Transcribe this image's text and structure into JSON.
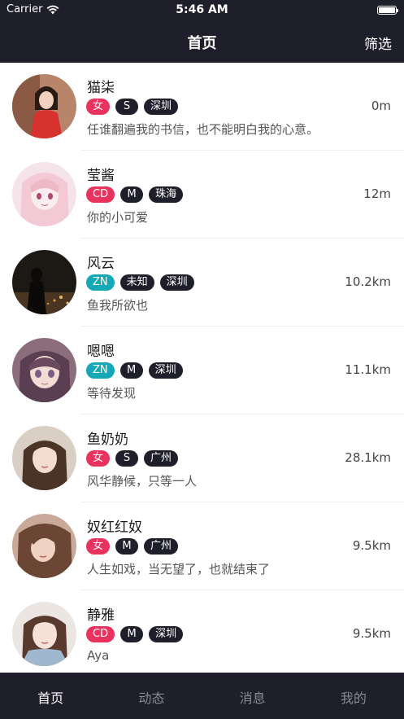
{
  "status": {
    "carrier": "Carrier",
    "time": "5:46 AM"
  },
  "nav": {
    "title": "首页",
    "filter": "筛选"
  },
  "users": [
    {
      "name": "猫柒",
      "tags": [
        {
          "text": "女",
          "color": "pink"
        },
        {
          "text": "S",
          "color": "dark"
        },
        {
          "text": "深圳",
          "color": "dark"
        }
      ],
      "distance": "0m",
      "desc": "任谁翻遍我的书信，也不能明白我的心意。"
    },
    {
      "name": "莹酱",
      "tags": [
        {
          "text": "CD",
          "color": "pink"
        },
        {
          "text": "M",
          "color": "dark"
        },
        {
          "text": "珠海",
          "color": "dark"
        }
      ],
      "distance": "12m",
      "desc": "你的小可爱"
    },
    {
      "name": "风云",
      "tags": [
        {
          "text": "ZN",
          "color": "teal"
        },
        {
          "text": "未知",
          "color": "dark"
        },
        {
          "text": "深圳",
          "color": "dark"
        }
      ],
      "distance": "10.2km",
      "desc": "鱼我所欲也"
    },
    {
      "name": "嗯嗯",
      "tags": [
        {
          "text": "ZN",
          "color": "teal"
        },
        {
          "text": "M",
          "color": "dark"
        },
        {
          "text": "深圳",
          "color": "dark"
        }
      ],
      "distance": "11.1km",
      "desc": "等待发现"
    },
    {
      "name": "鱼奶奶",
      "tags": [
        {
          "text": "女",
          "color": "pink"
        },
        {
          "text": "S",
          "color": "dark"
        },
        {
          "text": "广州",
          "color": "dark"
        }
      ],
      "distance": "28.1km",
      "desc": "风华静候，只等一人"
    },
    {
      "name": "奴红红奴",
      "tags": [
        {
          "text": "女",
          "color": "pink"
        },
        {
          "text": "M",
          "color": "dark"
        },
        {
          "text": "广州",
          "color": "dark"
        }
      ],
      "distance": "9.5km",
      "desc": "人生如戏，当无望了，也就结束了"
    },
    {
      "name": "静雅",
      "tags": [
        {
          "text": "CD",
          "color": "pink"
        },
        {
          "text": "M",
          "color": "dark"
        },
        {
          "text": "深圳",
          "color": "dark"
        }
      ],
      "distance": "9.5km",
      "desc": "Aya"
    }
  ],
  "tabs": [
    {
      "label": "首页",
      "active": true
    },
    {
      "label": "动态",
      "active": false
    },
    {
      "label": "消息",
      "active": false
    },
    {
      "label": "我的",
      "active": false
    }
  ]
}
